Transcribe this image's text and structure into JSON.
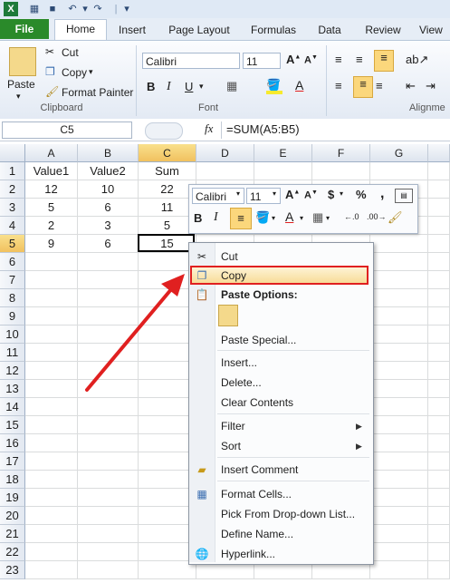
{
  "ribbon_tabs": {
    "file": "File",
    "home": "Home",
    "insert": "Insert",
    "page_layout": "Page Layout",
    "formulas": "Formulas",
    "data": "Data",
    "review": "Review",
    "view": "View"
  },
  "clipboard": {
    "paste": "Paste",
    "cut": "Cut",
    "copy": "Copy",
    "format_painter": "Format Painter",
    "label": "Clipboard"
  },
  "font": {
    "name": "Calibri",
    "size": "11",
    "label": "Font"
  },
  "alignment": {
    "label": "Alignme"
  },
  "formula_bar": {
    "name_box": "C5",
    "fx": "fx",
    "formula": "=SUM(A5:B5)"
  },
  "columns": [
    "A",
    "B",
    "C",
    "D",
    "E",
    "F",
    "G"
  ],
  "rows": [
    "1",
    "2",
    "3",
    "4",
    "5",
    "6",
    "7",
    "8",
    "9",
    "10",
    "11",
    "12",
    "13",
    "14",
    "15",
    "16",
    "17",
    "18",
    "19",
    "20",
    "21",
    "22",
    "23"
  ],
  "cells": [
    [
      "Value1",
      "Value2",
      "Sum"
    ],
    [
      "12",
      "10",
      "22"
    ],
    [
      "5",
      "6",
      "11"
    ],
    [
      "2",
      "3",
      "5"
    ],
    [
      "9",
      "6",
      "15"
    ]
  ],
  "mini_toolbar": {
    "font": "Calibri",
    "size": "11",
    "currency": "$",
    "percent": "%",
    "comma": ","
  },
  "context_menu": {
    "cut": "Cut",
    "copy": "Copy",
    "paste_options": "Paste Options:",
    "paste_special": "Paste Special...",
    "insert": "Insert...",
    "delete": "Delete...",
    "clear_contents": "Clear Contents",
    "filter": "Filter",
    "sort": "Sort",
    "insert_comment": "Insert Comment",
    "format_cells": "Format Cells...",
    "pick_list": "Pick From Drop-down List...",
    "define_name": "Define Name...",
    "hyperlink": "Hyperlink..."
  },
  "colors": {
    "file_tab": "#2a8a2a",
    "highlight": "#e02020",
    "annotation_arrow": "#e02020",
    "selected_header": "#f1c15f"
  }
}
